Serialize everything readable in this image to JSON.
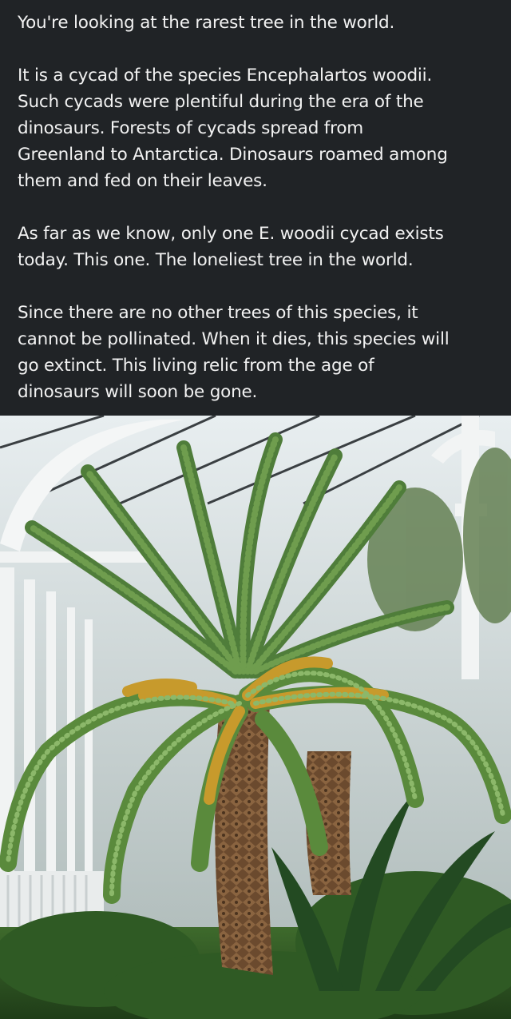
{
  "post": {
    "paragraphs": [
      {
        "lines": [
          "You're looking at the rarest tree in the world."
        ]
      },
      {
        "lines": [
          "It is a cycad of the species Encephalartos woodii.",
          "Such cycads were plentiful during the era of the",
          "dinosaurs. Forests of cycads spread from",
          "Greenland to Antarctica. Dinosaurs roamed among",
          "them and fed on their leaves."
        ]
      },
      {
        "lines": [
          "As far as we know, only one E. woodii cycad exists",
          "today. This one. The loneliest tree in the world."
        ]
      },
      {
        "lines": [
          "Since there are no other trees of this species, it",
          "cannot be pollinated. When it dies, this species will",
          "go extinct. This living relic from the age of",
          "dinosaurs will soon be gone."
        ]
      }
    ]
  },
  "colors": {
    "background": "#202326",
    "text": "#f2f2f2",
    "frond_green": "#4f7d3a",
    "frond_yellow": "#c79a2c",
    "trunk_brown": "#6b4a2e"
  }
}
